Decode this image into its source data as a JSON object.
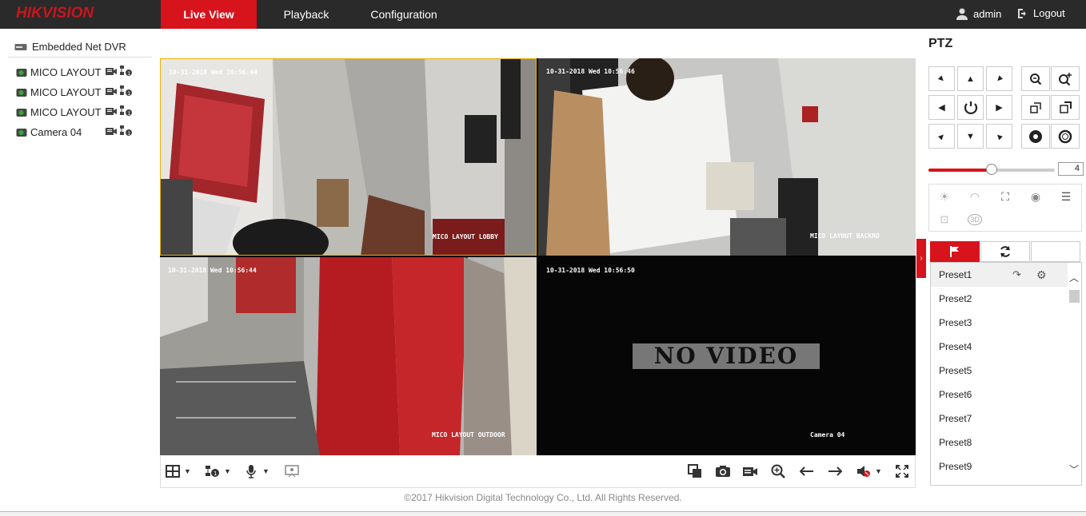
{
  "app": {
    "logo": "HIKVISION"
  },
  "nav": {
    "items": [
      "Live View",
      "Playback",
      "Configuration"
    ],
    "active": "Live View"
  },
  "user": {
    "name": "admin",
    "logout": "Logout"
  },
  "tree": {
    "root": "Embedded Net DVR",
    "cameras": [
      "MICO LAYOUT LOBBY",
      "MICO LAYOUT BACKROOM",
      "MICO LAYOUT OUTDOOR",
      "Camera 04"
    ]
  },
  "tiles": [
    {
      "timestamp": "10-31-2018 Wed 10:56:44",
      "label": "MICO LAYOUT LOBBY",
      "selected": true
    },
    {
      "timestamp": "10-31-2018 Wed 10:56:46",
      "label": "MICO LAYOUT BACKRO",
      "selected": false
    },
    {
      "timestamp": "10-31-2018 Wed 10:56:44",
      "label": "MICO LAYOUT OUTDOOR",
      "selected": false
    },
    {
      "timestamp": "10-31-2018 Wed 10:56:50",
      "label": "Camera 04",
      "selected": false,
      "no_video_text": "NO VIDEO"
    }
  ],
  "footer": {
    "copyright": "©2017 Hikvision Digital Technology Co., Ltd. All Rights Reserved."
  },
  "ptz": {
    "title": "PTZ",
    "speed": "4",
    "speed_fraction": 0.5,
    "presets": [
      "Preset1",
      "Preset2",
      "Preset3",
      "Preset4",
      "Preset5",
      "Preset6",
      "Preset7",
      "Preset8",
      "Preset9"
    ]
  },
  "colors": {
    "accent": "#d7131c",
    "topbar": "#2a2a2a"
  }
}
